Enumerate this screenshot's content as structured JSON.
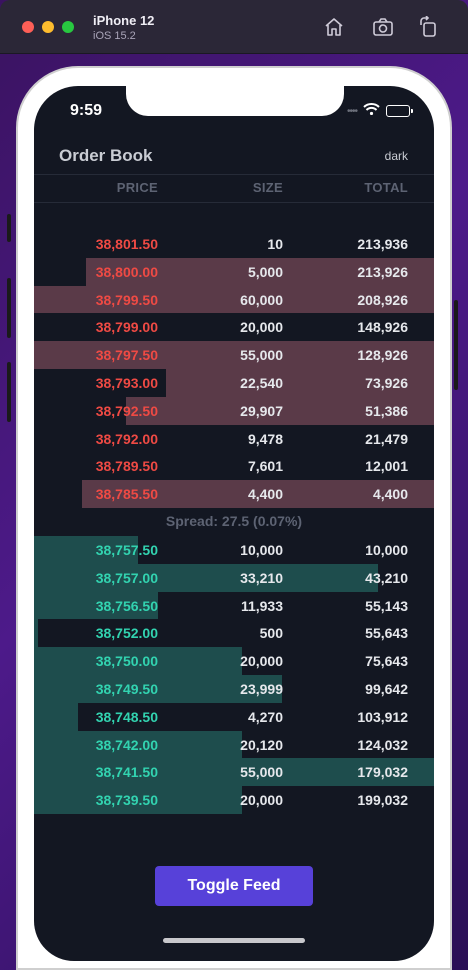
{
  "simulator": {
    "device_name": "iPhone 12",
    "os_version": "iOS 15.2"
  },
  "status_bar": {
    "time": "9:59",
    "signal": "••••"
  },
  "order_book": {
    "title": "Order Book",
    "theme_label": "dark",
    "columns": {
      "price": "PRICE",
      "size": "SIZE",
      "total": "TOTAL"
    },
    "asks": [
      {
        "price": "38,801.50",
        "size": "10",
        "total": "213,936",
        "depth": 0.0
      },
      {
        "price": "38,800.00",
        "size": "5,000",
        "total": "213,926",
        "depth": 0.0
      },
      {
        "price": "38,799.50",
        "size": "60,000",
        "total": "208,926",
        "depth": 0.0
      },
      {
        "price": "38,799.00",
        "size": "20,000",
        "total": "148,926",
        "depth": 0.0
      },
      {
        "price": "38,797.50",
        "size": "55,000",
        "total": "128,926",
        "depth": 0.0
      },
      {
        "price": "38,793.00",
        "size": "22,540",
        "total": "73,926",
        "depth": 0.0
      },
      {
        "price": "38,792.50",
        "size": "29,907",
        "total": "51,386",
        "depth": 0.0
      },
      {
        "price": "38,792.00",
        "size": "9,478",
        "total": "21,479",
        "depth": 0.0
      },
      {
        "price": "38,789.50",
        "size": "7,601",
        "total": "12,001",
        "depth": 0.0
      },
      {
        "price": "38,785.50",
        "size": "4,400",
        "total": "4,400",
        "depth": 0.0
      }
    ],
    "ask_fills": [
      0.0,
      0.87,
      1.0,
      0.0,
      1.0,
      0.67,
      0.77,
      0.0,
      0.0,
      0.88
    ],
    "spread_text": "Spread: 27.5 (0.07%)",
    "bids": [
      {
        "price": "38,757.50",
        "size": "10,000",
        "total": "10,000"
      },
      {
        "price": "38,757.00",
        "size": "33,210",
        "total": "43,210"
      },
      {
        "price": "38,756.50",
        "size": "11,933",
        "total": "55,143"
      },
      {
        "price": "38,752.00",
        "size": "500",
        "total": "55,643"
      },
      {
        "price": "38,750.00",
        "size": "20,000",
        "total": "75,643"
      },
      {
        "price": "38,749.50",
        "size": "23,999",
        "total": "99,642"
      },
      {
        "price": "38,748.50",
        "size": "4,270",
        "total": "103,912"
      },
      {
        "price": "38,742.00",
        "size": "20,120",
        "total": "124,032"
      },
      {
        "price": "38,741.50",
        "size": "55,000",
        "total": "179,032"
      },
      {
        "price": "38,739.50",
        "size": "20,000",
        "total": "199,032"
      }
    ],
    "bid_fills": [
      0.26,
      0.86,
      0.31,
      0.01,
      0.52,
      0.62,
      0.11,
      0.52,
      1.0,
      0.52
    ],
    "colors": {
      "ask_text": "#ef4a44",
      "bid_text": "#32d3b0",
      "ask_depth": "#5a3a48",
      "bid_depth": "#1e4d4d",
      "background": "#131722"
    }
  },
  "toggle_button": {
    "label": "Toggle Feed",
    "color": "#5741d9"
  },
  "icons": [
    "home-icon",
    "screenshot-icon",
    "rotate-icon",
    "wifi-icon",
    "battery-icon"
  ]
}
